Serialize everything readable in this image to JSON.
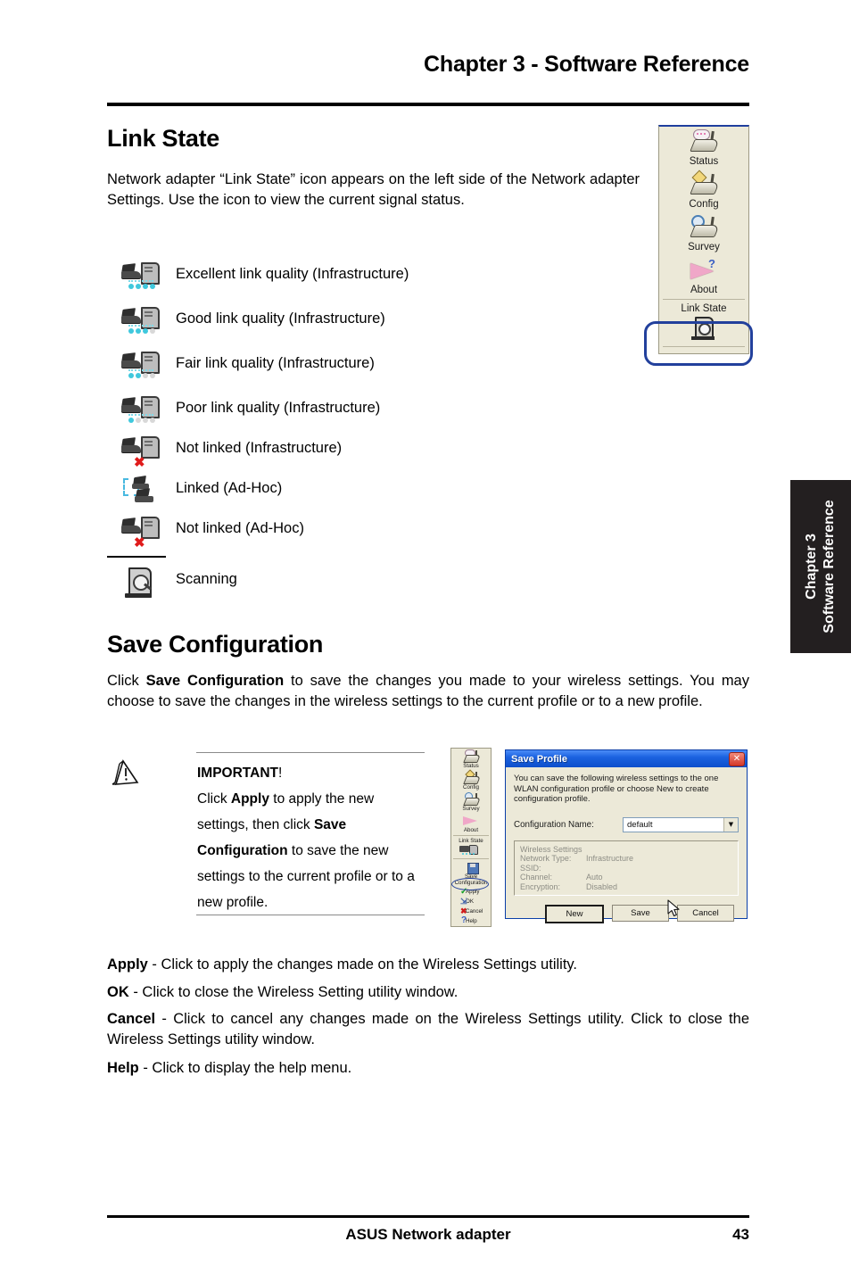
{
  "header": {
    "chapter_title": "Chapter 3 - Software Reference"
  },
  "link_state": {
    "heading": "Link State",
    "intro": "Network adapter “Link State” icon appears on the left side of the Network adapter Settings. Use the icon to view the current signal status.",
    "items": [
      {
        "label": "Excellent link quality (Infrastructure)",
        "icon": "signal-excellent-icon",
        "bars": 4
      },
      {
        "label": "Good link quality (Infrastructure)",
        "icon": "signal-good-icon",
        "bars": 3
      },
      {
        "label": "Fair link quality (Infrastructure)",
        "icon": "signal-fair-icon",
        "bars": 2
      },
      {
        "label": "Poor link quality (Infrastructure)",
        "icon": "signal-poor-icon",
        "bars": 1
      },
      {
        "label": "Not linked (Infrastructure)",
        "icon": "not-linked-infrastructure-icon",
        "bars": 0
      },
      {
        "label": "Linked (Ad-Hoc)",
        "icon": "linked-adhoc-icon",
        "bars": 0
      },
      {
        "label": "Not linked (Ad-Hoc)",
        "icon": "not-linked-adhoc-icon",
        "bars": 0
      },
      {
        "label": "Scanning",
        "icon": "scanning-icon",
        "bars": 0
      }
    ]
  },
  "utility_panel": {
    "items": [
      {
        "label": "Status",
        "icon": "status-icon"
      },
      {
        "label": "Config",
        "icon": "config-icon"
      },
      {
        "label": "Survey",
        "icon": "survey-icon"
      },
      {
        "label": "About",
        "icon": "about-icon"
      }
    ],
    "link_state_label": "Link State",
    "highlight_color": "#22409c",
    "background_color": "#ece9d8"
  },
  "save_configuration": {
    "heading": "Save Configuration",
    "intro": "Click <b>Save Configuration</b> to save the changes you made to your wireless settings. You may choose to save the changes in the wireless settings to the current profile or to a new profile.",
    "note": {
      "title": "IMPORTANT",
      "title_suffix": "!",
      "body": "Click <b>Apply</b> to apply the new settings, then click <b>Save Configuration</b> to save the new settings to the current profile or to a new profile."
    }
  },
  "mini_panel": {
    "items": [
      {
        "label": "Status",
        "icon": "status-icon"
      },
      {
        "label": "Config",
        "icon": "config-icon"
      },
      {
        "label": "Survey",
        "icon": "survey-icon"
      },
      {
        "label": "About",
        "icon": "about-icon"
      },
      {
        "label": "Link State",
        "icon": "link-state-icon"
      },
      {
        "label": "Save Configuration",
        "icon": "save-configuration-icon"
      },
      {
        "label": "Apply",
        "icon": "apply-check-icon"
      },
      {
        "label": "OK",
        "icon": "ok-icon"
      },
      {
        "label": "Cancel",
        "icon": "cancel-x-icon"
      },
      {
        "label": "Help",
        "icon": "help-question-icon"
      }
    ],
    "highlighted_item": "Apply"
  },
  "dialog": {
    "title": "Save Profile",
    "close_glyph": "✕",
    "description": "You can save the following wireless settings to the one WLAN configuration profile or choose New to create configuration profile.",
    "field_label": "Configuration Name:",
    "field_value": "default",
    "dropdown_arrow": "▼",
    "settings_title": "Wireless Settings",
    "settings": [
      {
        "key": "Network Type:",
        "value": "Infrastructure"
      },
      {
        "key": "SSID:",
        "value": ""
      },
      {
        "key": "Channel:",
        "value": "Auto"
      },
      {
        "key": "Encryption:",
        "value": "Disabled"
      }
    ],
    "buttons": [
      {
        "label": "New",
        "accesskey": "N",
        "default": true
      },
      {
        "label": "Save",
        "accesskey": "S",
        "default": false
      },
      {
        "label": "Cancel",
        "accesskey": "C",
        "default": false
      }
    ],
    "titlebar_color": "#0d4fcb",
    "close_color": "#d4372a"
  },
  "button_descriptions": [
    {
      "term": "Apply",
      "text": " - Click to apply the changes made on the Wireless Settings utility."
    },
    {
      "term": "OK",
      "text": " - Click to close the Wireless Setting utility window."
    },
    {
      "term": "Cancel",
      "text": " - Click to cancel any changes made on the Wireless Settings utility. Click to close the Wireless Settings utility window."
    },
    {
      "term": "Help",
      "text": " - Click to display the help menu."
    }
  ],
  "side_tab": {
    "line1": "Chapter 3",
    "line2": "Software Reference"
  },
  "footer": {
    "title": "ASUS Network adapter",
    "page_number": "43"
  }
}
